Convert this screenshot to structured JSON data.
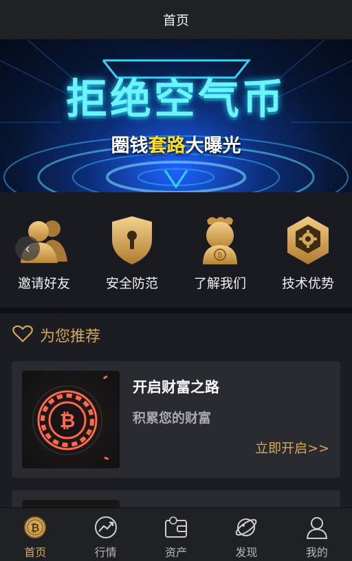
{
  "header": {
    "title": "首页"
  },
  "banner": {
    "headline": "拒绝空气币",
    "sub_prefix": "圈钱",
    "sub_highlight": "套路",
    "sub_suffix": "大曝光"
  },
  "quick_links": [
    {
      "label": "邀请好友",
      "icon": "users-icon"
    },
    {
      "label": "安全防范",
      "icon": "shield-lock-icon"
    },
    {
      "label": "了解我们",
      "icon": "mascot-icon"
    },
    {
      "label": "技术优势",
      "icon": "gear-hexagon-icon"
    }
  ],
  "carousel": {
    "prev_glyph": "‹"
  },
  "recommend": {
    "heading": "为您推荐",
    "card": {
      "title": "开启财富之路",
      "subtitle": "积累您的财富",
      "cta": "立即开启>>"
    }
  },
  "tabs": [
    {
      "label": "首页",
      "icon": "bitcoin-icon",
      "active": true
    },
    {
      "label": "行情",
      "icon": "trend-icon",
      "active": false
    },
    {
      "label": "资产",
      "icon": "wallet-icon",
      "active": false
    },
    {
      "label": "发现",
      "icon": "planet-icon",
      "active": false
    },
    {
      "label": "我的",
      "icon": "user-icon",
      "active": false
    }
  ],
  "colors": {
    "gold": "#d4a85a",
    "background": "#1c1d22",
    "card": "#2a2b31",
    "banner_cyan": "#6ff2ff",
    "banner_highlight": "#ffe227"
  }
}
